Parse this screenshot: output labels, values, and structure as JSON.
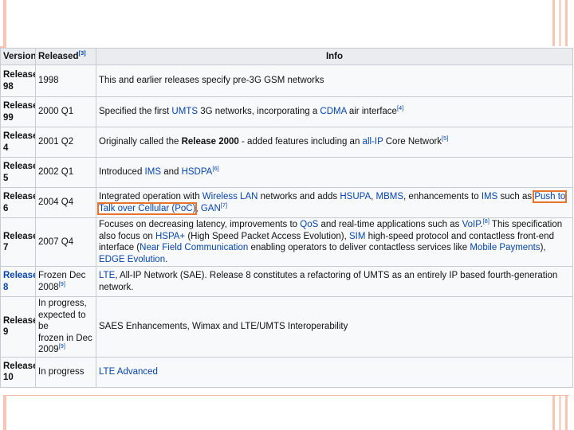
{
  "table": {
    "headers": {
      "version": "Version",
      "released": "Released",
      "released_ref": "[3]",
      "info": "Info"
    },
    "rows": [
      {
        "version": [
          "Release",
          "98"
        ],
        "released": [
          "1998"
        ],
        "info": [
          {
            "t": "This and earlier releases specify pre-3G GSM networks"
          }
        ]
      },
      {
        "version": [
          "Release",
          "99"
        ],
        "released": [
          "2000 Q1"
        ],
        "info": [
          {
            "t": "Specified the first "
          },
          {
            "t": "UMTS",
            "link": true
          },
          {
            "t": " 3G networks, incorporating a "
          },
          {
            "t": "CDMA",
            "link": true
          },
          {
            "t": " air interface"
          },
          {
            "t": "[4]",
            "sup": true
          }
        ]
      },
      {
        "version": [
          "Release",
          "4"
        ],
        "released": [
          "2001 Q2"
        ],
        "info": [
          {
            "t": "Originally called the "
          },
          {
            "t": "Release 2000",
            "bold": true
          },
          {
            "t": " - added features including an "
          },
          {
            "t": "all-IP",
            "link": true
          },
          {
            "t": " Core Network"
          },
          {
            "t": "[5]",
            "sup": true
          }
        ]
      },
      {
        "version": [
          "Release",
          "5"
        ],
        "released": [
          "2002 Q1"
        ],
        "info": [
          {
            "t": "Introduced "
          },
          {
            "t": "IMS",
            "link": true
          },
          {
            "t": " and "
          },
          {
            "t": "HSDPA",
            "link": true
          },
          {
            "t": "[6]",
            "sup": true
          }
        ]
      },
      {
        "version": [
          "Release",
          "6"
        ],
        "released": [
          "2004 Q4"
        ],
        "info": [
          {
            "t": "Integrated operation with "
          },
          {
            "t": "Wireless LAN",
            "link": true
          },
          {
            "t": " networks and adds "
          },
          {
            "t": "HSUPA",
            "link": true
          },
          {
            "t": ", "
          },
          {
            "t": "MBMS",
            "link": true
          },
          {
            "t": ", enhancements to "
          },
          {
            "t": "IMS",
            "link": true
          },
          {
            "t": " such as "
          },
          {
            "t": "Push to Talk over Cellular (PoC)",
            "link": true,
            "hl": true
          },
          {
            "t": ", "
          },
          {
            "t": "GAN",
            "link": true
          },
          {
            "t": "[7]",
            "sup": true
          }
        ]
      },
      {
        "version": [
          "Release",
          "7"
        ],
        "released": [
          "2007 Q4"
        ],
        "info": [
          {
            "t": "Focuses on decreasing latency, improvements to "
          },
          {
            "t": "QoS",
            "link": true
          },
          {
            "t": " and real-time applications such as "
          },
          {
            "t": "VoIP",
            "link": true
          },
          {
            "t": ".",
            "plain": true
          },
          {
            "t": "[8]",
            "sup": true
          },
          {
            "t": " This specification also focus on "
          },
          {
            "t": "HSPA+",
            "link": true
          },
          {
            "t": " (High Speed Packet Access Evolution), "
          },
          {
            "t": "SIM",
            "link": true
          },
          {
            "t": " high-speed protocol and contactless front-end interface ("
          },
          {
            "t": "Near Field Communication",
            "link": true
          },
          {
            "t": " enabling operators to deliver contactless services like "
          },
          {
            "t": "Mobile Payments",
            "link": true
          },
          {
            "t": "), "
          },
          {
            "t": "EDGE Evolution",
            "link": true
          },
          {
            "t": "."
          }
        ]
      },
      {
        "version": [
          "Release",
          "8"
        ],
        "version_link": true,
        "released": [
          "Frozen Dec",
          "2008"
        ],
        "released_ref": "[9]",
        "info": [
          {
            "t": "LTE",
            "link": true
          },
          {
            "t": ", All-IP Network (SAE). Release 8 constitutes a refactoring of UMTS as an entirely IP based fourth-generation network."
          }
        ]
      },
      {
        "version": [
          "Release",
          "9"
        ],
        "released": [
          "In progress,",
          "expected to be",
          "frozen in Dec",
          "2009"
        ],
        "released_ref": "[9]",
        "info": [
          {
            "t": "SAES Enhancements, Wimax and LTE/UMTS Interoperability"
          }
        ]
      },
      {
        "version": [
          "Release",
          "10"
        ],
        "released": [
          "In progress"
        ],
        "info": [
          {
            "t": "LTE Advanced",
            "link": true
          }
        ]
      }
    ]
  },
  "colors": {
    "link": "#0645ad",
    "highlight": "#e8742c",
    "header_bg": "#eaecf0",
    "cell_bg": "#f8f9fa",
    "border": "#c8ccd1",
    "deco": "#f6c6b4"
  }
}
